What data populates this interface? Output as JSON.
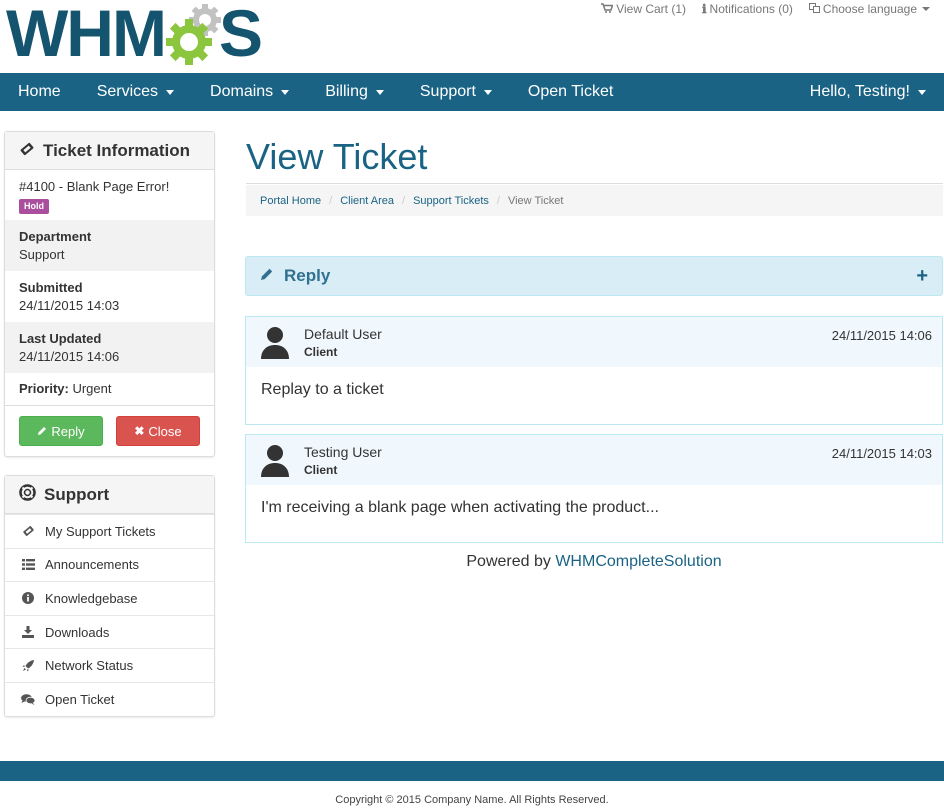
{
  "brand": {
    "logo_left": "WHM",
    "logo_right": "S",
    "colors": {
      "navy": "#15546e",
      "gear_green": "#8cc63f",
      "gear_grey": "#c2c2c2"
    }
  },
  "toplinks": {
    "view_cart": "View Cart (1)",
    "notifications": "Notifications (0)",
    "language": "Choose language"
  },
  "nav": {
    "items": [
      {
        "label": "Home",
        "dropdown": false
      },
      {
        "label": "Services",
        "dropdown": true
      },
      {
        "label": "Domains",
        "dropdown": true
      },
      {
        "label": "Billing",
        "dropdown": true
      },
      {
        "label": "Support",
        "dropdown": true
      },
      {
        "label": "Open Ticket",
        "dropdown": false
      }
    ],
    "user": "Hello, Testing!",
    "bg_color": "#1a6385"
  },
  "ticket_info": {
    "heading": "Ticket Information",
    "subject": "#4100 - Blank Page Error!",
    "status": "Hold",
    "department_label": "Department",
    "department": "Support",
    "submitted_label": "Submitted",
    "submitted": "24/11/2015 14:03",
    "updated_label": "Last Updated",
    "updated": "24/11/2015 14:06",
    "priority_label": "Priority:",
    "priority": "Urgent",
    "reply_button": "Reply",
    "close_button": "Close"
  },
  "support": {
    "heading": "Support",
    "items": [
      {
        "label": "My Support Tickets",
        "icon": "ticket-icon"
      },
      {
        "label": "Announcements",
        "icon": "list-icon"
      },
      {
        "label": "Knowledgebase",
        "icon": "info-icon"
      },
      {
        "label": "Downloads",
        "icon": "download-icon"
      },
      {
        "label": "Network Status",
        "icon": "rocket-icon"
      },
      {
        "label": "Open Ticket",
        "icon": "comments-icon"
      }
    ]
  },
  "main": {
    "title": "View Ticket",
    "breadcrumb": [
      "Portal Home",
      "Client Area",
      "Support Tickets",
      "View Ticket"
    ],
    "reply_panel": "Reply",
    "reply_toggle": "+",
    "messages": [
      {
        "name": "Default User",
        "role": "Client",
        "date": "24/11/2015 14:06",
        "body": "Replay to a ticket"
      },
      {
        "name": "Testing User",
        "role": "Client",
        "date": "24/11/2015 14:03",
        "body": "I'm receiving a blank page when activating the product..."
      }
    ],
    "powered_prefix": "Powered by",
    "powered_link": "WHMCompleteSolution"
  },
  "footer": {
    "copyright": "Copyright © 2015 Company Name. All Rights Reserved."
  }
}
